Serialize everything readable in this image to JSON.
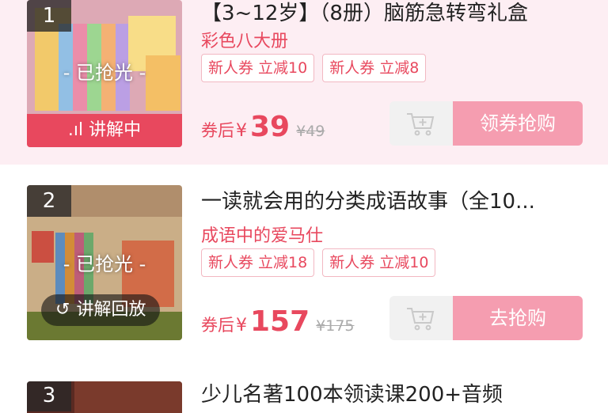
{
  "items": [
    {
      "rank": "1",
      "title": "【3~12岁】（8册）脑筋急转弯礼盒",
      "subtitle": "彩色八大册",
      "sold_out": "- 已抢光 -",
      "live_label": ".ıl 讲解中",
      "coupons": [
        "新人券  立减10",
        "新人券  立减8"
      ],
      "price_label": "券后",
      "currency": "¥",
      "price": "39",
      "original_price": "¥49",
      "buy_label": "领券抢购"
    },
    {
      "rank": "2",
      "title": "一读就会用的分类成语故事（全10...",
      "subtitle": "成语中的爱马仕",
      "sold_out": "- 已抢光 -",
      "replay_label": "讲解回放",
      "coupons": [
        "新人券  立减18",
        "新人券  立减10"
      ],
      "price_label": "券后",
      "currency": "¥",
      "price": "157",
      "original_price": "¥175",
      "buy_label": "去抢购"
    },
    {
      "rank": "3",
      "title": "少儿名著100本领读课200+音频"
    }
  ],
  "colors": {
    "accent": "#e8485e",
    "buy_button": "#f59db0",
    "highlight_bg": "#fdeef3"
  }
}
